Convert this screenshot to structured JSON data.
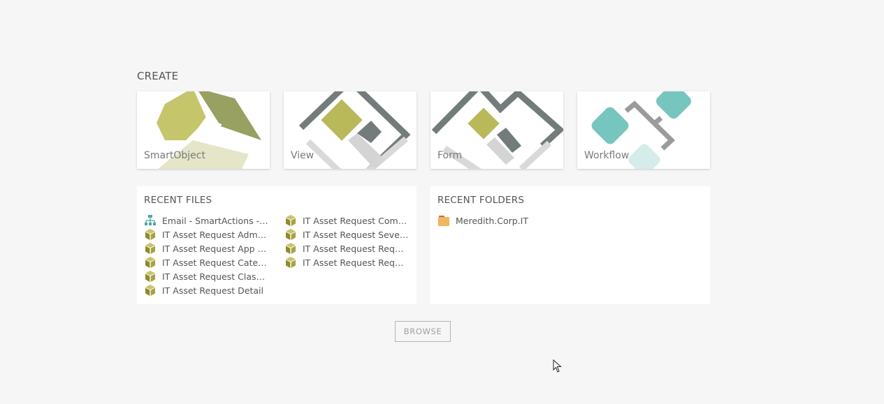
{
  "create": {
    "title": "CREATE",
    "tiles": [
      {
        "label": "SmartObject",
        "icon": "smartobject-icon"
      },
      {
        "label": "View",
        "icon": "view-icon"
      },
      {
        "label": "Form",
        "icon": "form-icon"
      },
      {
        "label": "Workflow",
        "icon": "workflow-icon"
      }
    ]
  },
  "recent_files": {
    "title": "RECENT FILES",
    "items": [
      {
        "label": "Email - SmartActions - Test",
        "icon": "workflow-file-icon"
      },
      {
        "label": "IT Asset Request Administrator",
        "icon": "smartobject-file-icon"
      },
      {
        "label": "IT Asset Request App Settings",
        "icon": "smartobject-file-icon"
      },
      {
        "label": "IT Asset Request Category",
        "icon": "smartobject-file-icon"
      },
      {
        "label": "IT Asset Request Classification",
        "icon": "smartobject-file-icon"
      },
      {
        "label": "IT Asset Request Detail",
        "icon": "smartobject-file-icon"
      },
      {
        "label": "IT Asset Request Comments",
        "icon": "smartobject-file-icon"
      },
      {
        "label": "IT Asset Request Severity",
        "icon": "smartobject-file-icon"
      },
      {
        "label": "IT Asset Request Requester",
        "icon": "smartobject-file-icon"
      },
      {
        "label": "IT Asset Request Requests",
        "icon": "smartobject-file-icon"
      }
    ]
  },
  "recent_folders": {
    "title": "RECENT FOLDERS",
    "items": [
      {
        "label": "Meredith.Corp.IT",
        "icon": "folder-icon"
      }
    ]
  },
  "browse_label": "BROWSE",
  "colors": {
    "background": "#f6f6f6",
    "smartobject_olive": "#b9b95a",
    "view_gray": "#737b7b",
    "workflow_teal": "#76c6bf",
    "folder_orange": "#f0b55f"
  }
}
